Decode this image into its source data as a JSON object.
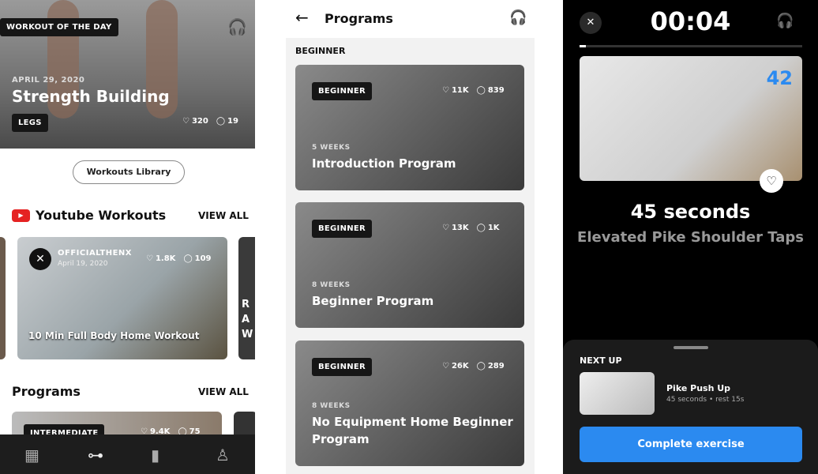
{
  "screen1": {
    "hero": {
      "badge": "WORKOUT OF THE DAY",
      "date": "APRIL 29, 2020",
      "title": "Strength Building",
      "tag": "LEGS",
      "likes": "320",
      "comments": "19"
    },
    "library_button": "Workouts Library",
    "youtube": {
      "title": "Youtube Workouts",
      "view_all": "VIEW ALL",
      "card": {
        "channel": "OFFICIALTHENX",
        "date": "April 19, 2020",
        "likes": "1.8K",
        "comments": "109",
        "title": "10 Min Full Body Home Workout"
      },
      "next_peek": "R A W"
    },
    "programs": {
      "title": "Programs",
      "view_all": "VIEW ALL",
      "card": {
        "tag": "INTERMEDIATE",
        "likes": "9.4K",
        "comments": "75"
      }
    },
    "nav": [
      "grid-icon",
      "dumbbell-icon",
      "chart-icon",
      "profile-icon"
    ]
  },
  "screen2": {
    "title": "Programs",
    "section": "BEGINNER",
    "cards": [
      {
        "tag": "BEGINNER",
        "likes": "11K",
        "comments": "839",
        "weeks": "5 WEEKS",
        "title": "Introduction Program"
      },
      {
        "tag": "BEGINNER",
        "likes": "13K",
        "comments": "1K",
        "weeks": "8 WEEKS",
        "title": "Beginner Program"
      },
      {
        "tag": "BEGINNER",
        "likes": "26K",
        "comments": "289",
        "weeks": "8 WEEKS",
        "title": "No Equipment Home Beginner Program"
      }
    ]
  },
  "screen3": {
    "timer": "00:04",
    "progress": 0.03,
    "rep_count": "42",
    "duration": "45 seconds",
    "exercise": "Elevated Pike Shoulder Taps",
    "next_up": {
      "label": "NEXT UP",
      "name": "Pike Push Up",
      "detail": "45 seconds • rest 15s"
    },
    "complete_button": "Complete exercise",
    "accent": "#2b8af0"
  }
}
